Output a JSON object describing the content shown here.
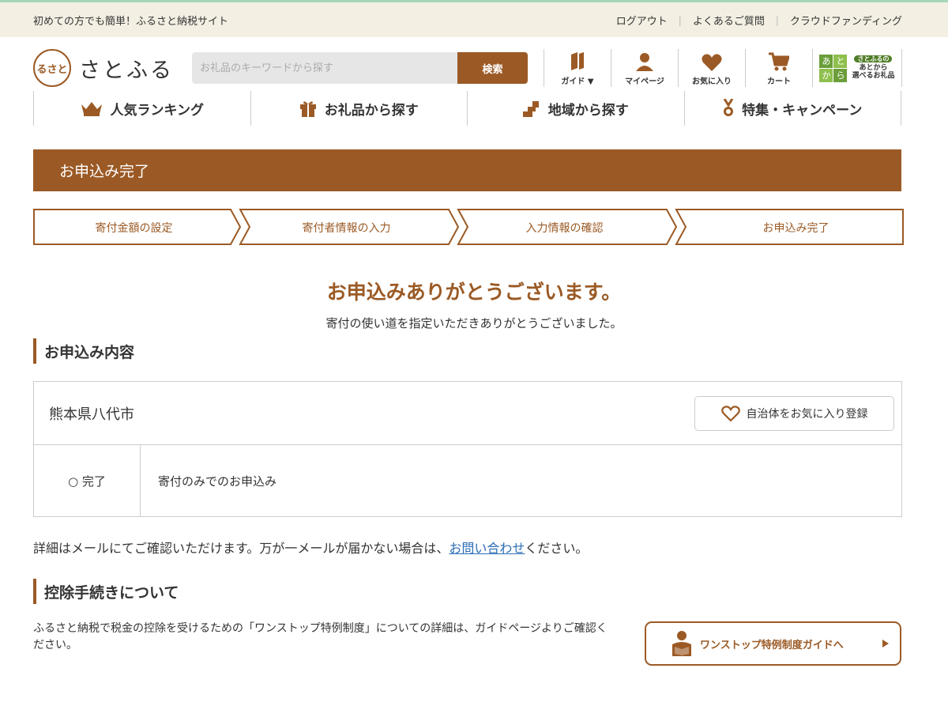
{
  "topbar": {
    "tagline": "初めての方でも簡単！ふるさと納税サイト",
    "links": [
      "ログアウト",
      "よくあるご質問",
      "クラウドファンディング"
    ]
  },
  "logo": {
    "mark": "るさと",
    "name": "さとふる"
  },
  "search": {
    "placeholder": "お礼品のキーワードから探す",
    "button": "検索"
  },
  "icon_nav": [
    {
      "label": "ガイド ▼",
      "icon": "book-icon"
    },
    {
      "label": "マイページ",
      "icon": "person-icon"
    },
    {
      "label": "お気に入り",
      "icon": "heart-icon"
    },
    {
      "label": "カート",
      "icon": "cart-icon"
    }
  ],
  "atokara": {
    "chars": [
      "あ",
      "と",
      "か",
      "ら"
    ],
    "pill": "さとふるの",
    "line1": "あとから",
    "line2": "選べるお礼品"
  },
  "main_nav": [
    {
      "label": "人気ランキング",
      "icon": "crown-icon"
    },
    {
      "label": "お礼品から探す",
      "icon": "gift-icon"
    },
    {
      "label": "地域から探す",
      "icon": "map-icon"
    },
    {
      "label": "特集・キャンペーン",
      "icon": "medal-icon"
    }
  ],
  "banner": "お申込み完了",
  "steps": [
    "寄付金額の設定",
    "寄付者情報の入力",
    "入力情報の確認",
    "お申込み完了"
  ],
  "thanks": {
    "title": "お申込みありがとうございます。",
    "sub": "寄付の使い道を指定いただきありがとうございました。"
  },
  "order_section": {
    "heading": "お申込み内容",
    "city": "熊本県八代市",
    "fav_button": "自治体をお気に入り登録",
    "status": "○ 完了",
    "type": "寄付のみでのお申込み"
  },
  "note": {
    "before": "詳細はメールにてご確認いただけます。万が一メールが届かない場合は、",
    "link": "お問い合わせ",
    "after": "ください。"
  },
  "deduction": {
    "heading": "控除手続きについて",
    "text": "ふるさと納税で税金の控除を受けるための「ワンストップ特例制度」についての詳細は、ガイドページよりご確認ください。",
    "button": "ワンストップ特例制度ガイドへ"
  },
  "colors": {
    "brand": "#9b5a25",
    "topbar_bg": "#f3efe3",
    "link": "#2a6db5",
    "atokara_green": "#6b9e3a"
  }
}
